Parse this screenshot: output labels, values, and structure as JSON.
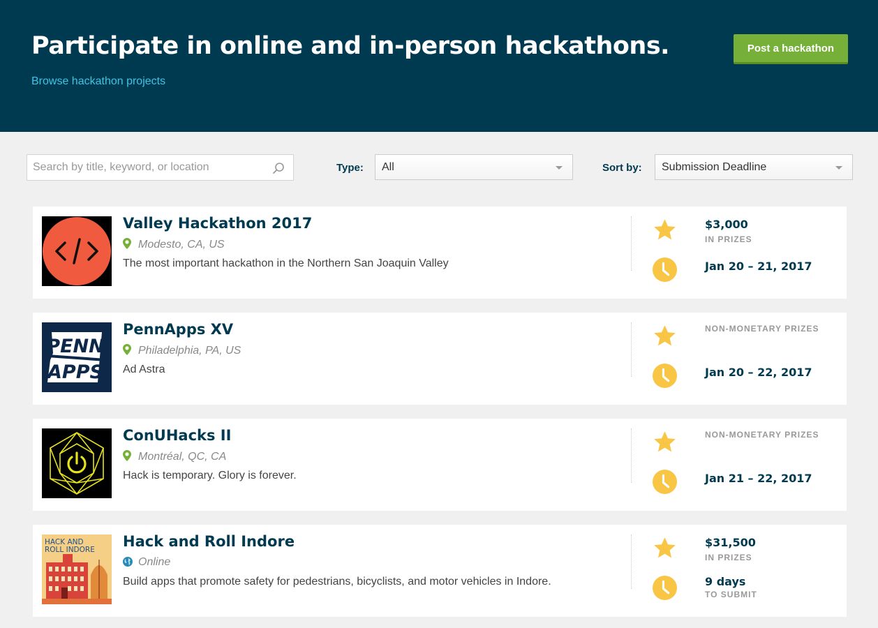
{
  "hero": {
    "title": "Participate in online and in-person hackathons.",
    "browse_link": "Browse hackathon projects",
    "post_button": "Post a hackathon"
  },
  "filters": {
    "search_placeholder": "Search by title, keyword, or location",
    "type_label": "Type:",
    "type_value": "All",
    "sort_label": "Sort by:",
    "sort_value": "Submission Deadline"
  },
  "colors": {
    "header_bg": "#003a50",
    "accent_green": "#76b039",
    "link_cyan": "#3fc4e4",
    "icon_yellow": "#f9c545"
  },
  "hackathons": [
    {
      "title": "Valley Hackathon 2017",
      "location": "Modesto, CA, US",
      "location_icon": "map-pin-icon",
      "description": "The most important hackathon in the Northern San Joaquin Valley",
      "prize_amount": "$3,000",
      "prize_sub": "IN PRIZES",
      "date": "Jan 20 – 21, 2017"
    },
    {
      "title": "PennApps XV",
      "location": "Philadelphia, PA, US",
      "location_icon": "map-pin-icon",
      "description": "Ad Astra",
      "prize_text": "NON-MONETARY PRIZES",
      "date": "Jan 20 – 22, 2017",
      "logo_text_1": "PENN",
      "logo_text_2": "APPS"
    },
    {
      "title": "ConUHacks II",
      "location": "Montréal, QC, CA",
      "location_icon": "map-pin-icon",
      "description": "Hack is temporary. Glory is forever.",
      "prize_text": "NON-MONETARY PRIZES",
      "date": "Jan 21 – 22, 2017"
    },
    {
      "title": "Hack and Roll Indore",
      "location": "Online",
      "location_icon": "globe-icon",
      "description": "Build apps that promote safety for pedestrians, bicyclists, and motor vehicles in Indore.",
      "prize_amount": "$31,500",
      "prize_sub": "IN PRIZES",
      "days": "9 days",
      "days_sub": "TO SUBMIT",
      "logo_text_1": "HACK AND",
      "logo_text_2": "ROLL INDORE"
    }
  ]
}
